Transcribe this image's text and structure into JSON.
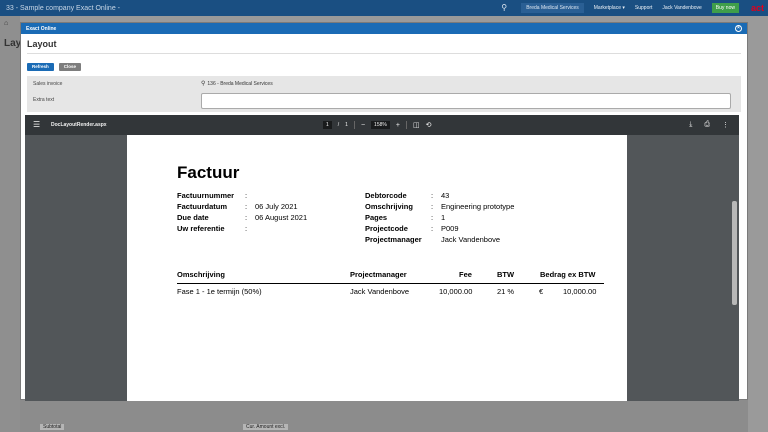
{
  "app": {
    "title": "33 - Sample company Exact Online -",
    "company": "Breda Medical Services",
    "marketplace": "Marketplace ▾",
    "support": "Support",
    "user": "Jack Vandenbove",
    "buy_now": "Buy now",
    "logo": "act",
    "page_title": "Lay",
    "subtotal": "Subtotal",
    "amount": "Cur. Amount excl."
  },
  "modal": {
    "header": "Exact Online",
    "title": "Layout",
    "refresh_label": "Refresh",
    "close_label": "Close",
    "sales_invoice_label": "Sales invoice",
    "sales_invoice_value": "136 - Breda Medical Services",
    "extra_text_label": "Extra text",
    "extra_text_value": ""
  },
  "pdf": {
    "filename": "DocLayoutRender.aspx",
    "page_current": "1",
    "page_sep": "/",
    "page_total": "1",
    "zoom": "158%",
    "minus": "−",
    "plus": "+"
  },
  "invoice": {
    "title": "Factuur",
    "left_labels": [
      "Factuurnummer",
      "Factuurdatum",
      "Due date",
      "Uw referentie"
    ],
    "left_values": [
      "",
      "06 July 2021",
      "06 August 2021",
      ""
    ],
    "right_labels": [
      "Debtorcode",
      "Omschrijving",
      "Pages",
      "Projectcode",
      "Projectmanager"
    ],
    "right_values": [
      "43",
      "Engineering prototype",
      "1",
      "P009",
      "Jack Vandenbove"
    ],
    "colon": ":",
    "columns": {
      "description": "Omschrijving",
      "manager": "Projectmanager",
      "fee": "Fee",
      "vat": "BTW",
      "amount": "Bedrag ex BTW"
    },
    "row": {
      "description": "Fase 1 - 1e termijn (50%)",
      "manager": "Jack Vandenbove",
      "fee": "10,000.00",
      "vat": "21 %",
      "currency": "€",
      "amount": "10,000.00"
    }
  }
}
